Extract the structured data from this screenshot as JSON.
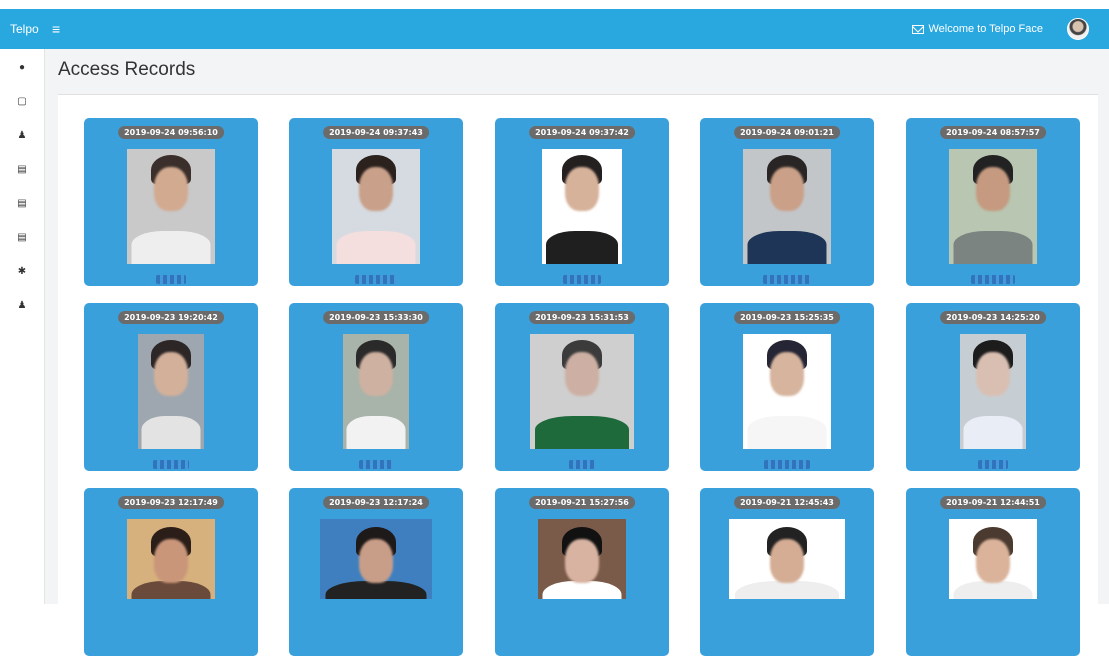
{
  "app": {
    "brand": "Telpo",
    "welcome_text": "Welcome to Telpo Face"
  },
  "icons": {
    "menu": "hamburger-icon",
    "mail": "envelope-icon",
    "user_avatar": "avatar"
  },
  "sidebar": {
    "items": [
      {
        "icon": "home-icon",
        "glyph": "●"
      },
      {
        "icon": "device-icon",
        "glyph": "▢"
      },
      {
        "icon": "user-icon",
        "glyph": "♟"
      },
      {
        "icon": "document-icon",
        "glyph": "▤"
      },
      {
        "icon": "document-icon",
        "glyph": "▤"
      },
      {
        "icon": "edit-document-icon",
        "glyph": "▤"
      },
      {
        "icon": "gear-icon",
        "glyph": "✱"
      },
      {
        "icon": "user-icon",
        "glyph": "♟"
      }
    ]
  },
  "page": {
    "title": "Access Records"
  },
  "colors": {
    "topbar": "#29a8e0",
    "card": "#3aa0dc",
    "timestamp_badge": "#6b6b6b"
  },
  "records": [
    {
      "timestamp": "2019-09-24 09:56:10"
    },
    {
      "timestamp": "2019-09-24 09:37:43"
    },
    {
      "timestamp": "2019-09-24 09:37:42"
    },
    {
      "timestamp": "2019-09-24 09:01:21"
    },
    {
      "timestamp": "2019-09-24 08:57:57"
    },
    {
      "timestamp": "2019-09-23 19:20:42"
    },
    {
      "timestamp": "2019-09-23 15:33:30"
    },
    {
      "timestamp": "2019-09-23 15:31:53"
    },
    {
      "timestamp": "2019-09-23 15:25:35"
    },
    {
      "timestamp": "2019-09-23 14:25:20"
    },
    {
      "timestamp": "2019-09-23 12:17:49"
    },
    {
      "timestamp": "2019-09-23 12:17:24"
    },
    {
      "timestamp": "2019-09-21 15:27:56"
    },
    {
      "timestamp": "2019-09-21 12:45:43"
    },
    {
      "timestamp": "2019-09-21 12:44:51"
    }
  ]
}
